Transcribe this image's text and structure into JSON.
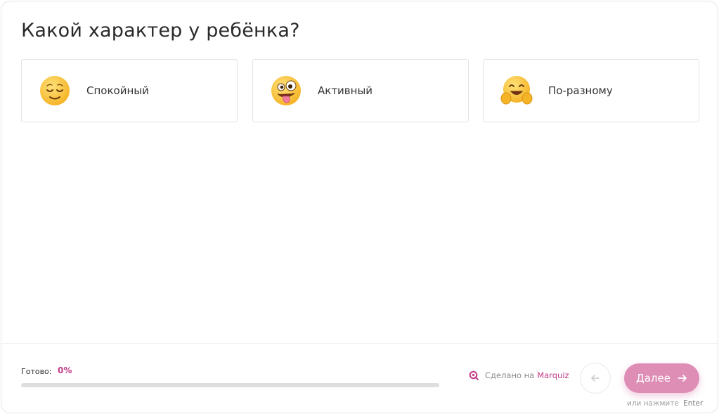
{
  "question": {
    "title": "Какой характер у ребёнка?"
  },
  "options": [
    {
      "label": "Спокойный",
      "icon": "relieved-face-icon"
    },
    {
      "label": "Активный",
      "icon": "zany-face-icon"
    },
    {
      "label": "По-разному",
      "icon": "hugging-face-icon"
    }
  ],
  "progress": {
    "label": "Готово:",
    "value_text": "0%",
    "value": 0
  },
  "credit": {
    "prefix": "Сделано на",
    "brand": "Marquiz"
  },
  "navigation": {
    "back_icon": "arrow-left-icon",
    "next_label": "Далее",
    "next_icon": "arrow-right-icon",
    "hint_prefix": "или нажмите",
    "hint_key": "Enter"
  },
  "colors": {
    "accent": "#c23d86",
    "next_button": "#de8db5",
    "progress_track": "#dedede",
    "emoji_yellow": "#f9c63a"
  }
}
